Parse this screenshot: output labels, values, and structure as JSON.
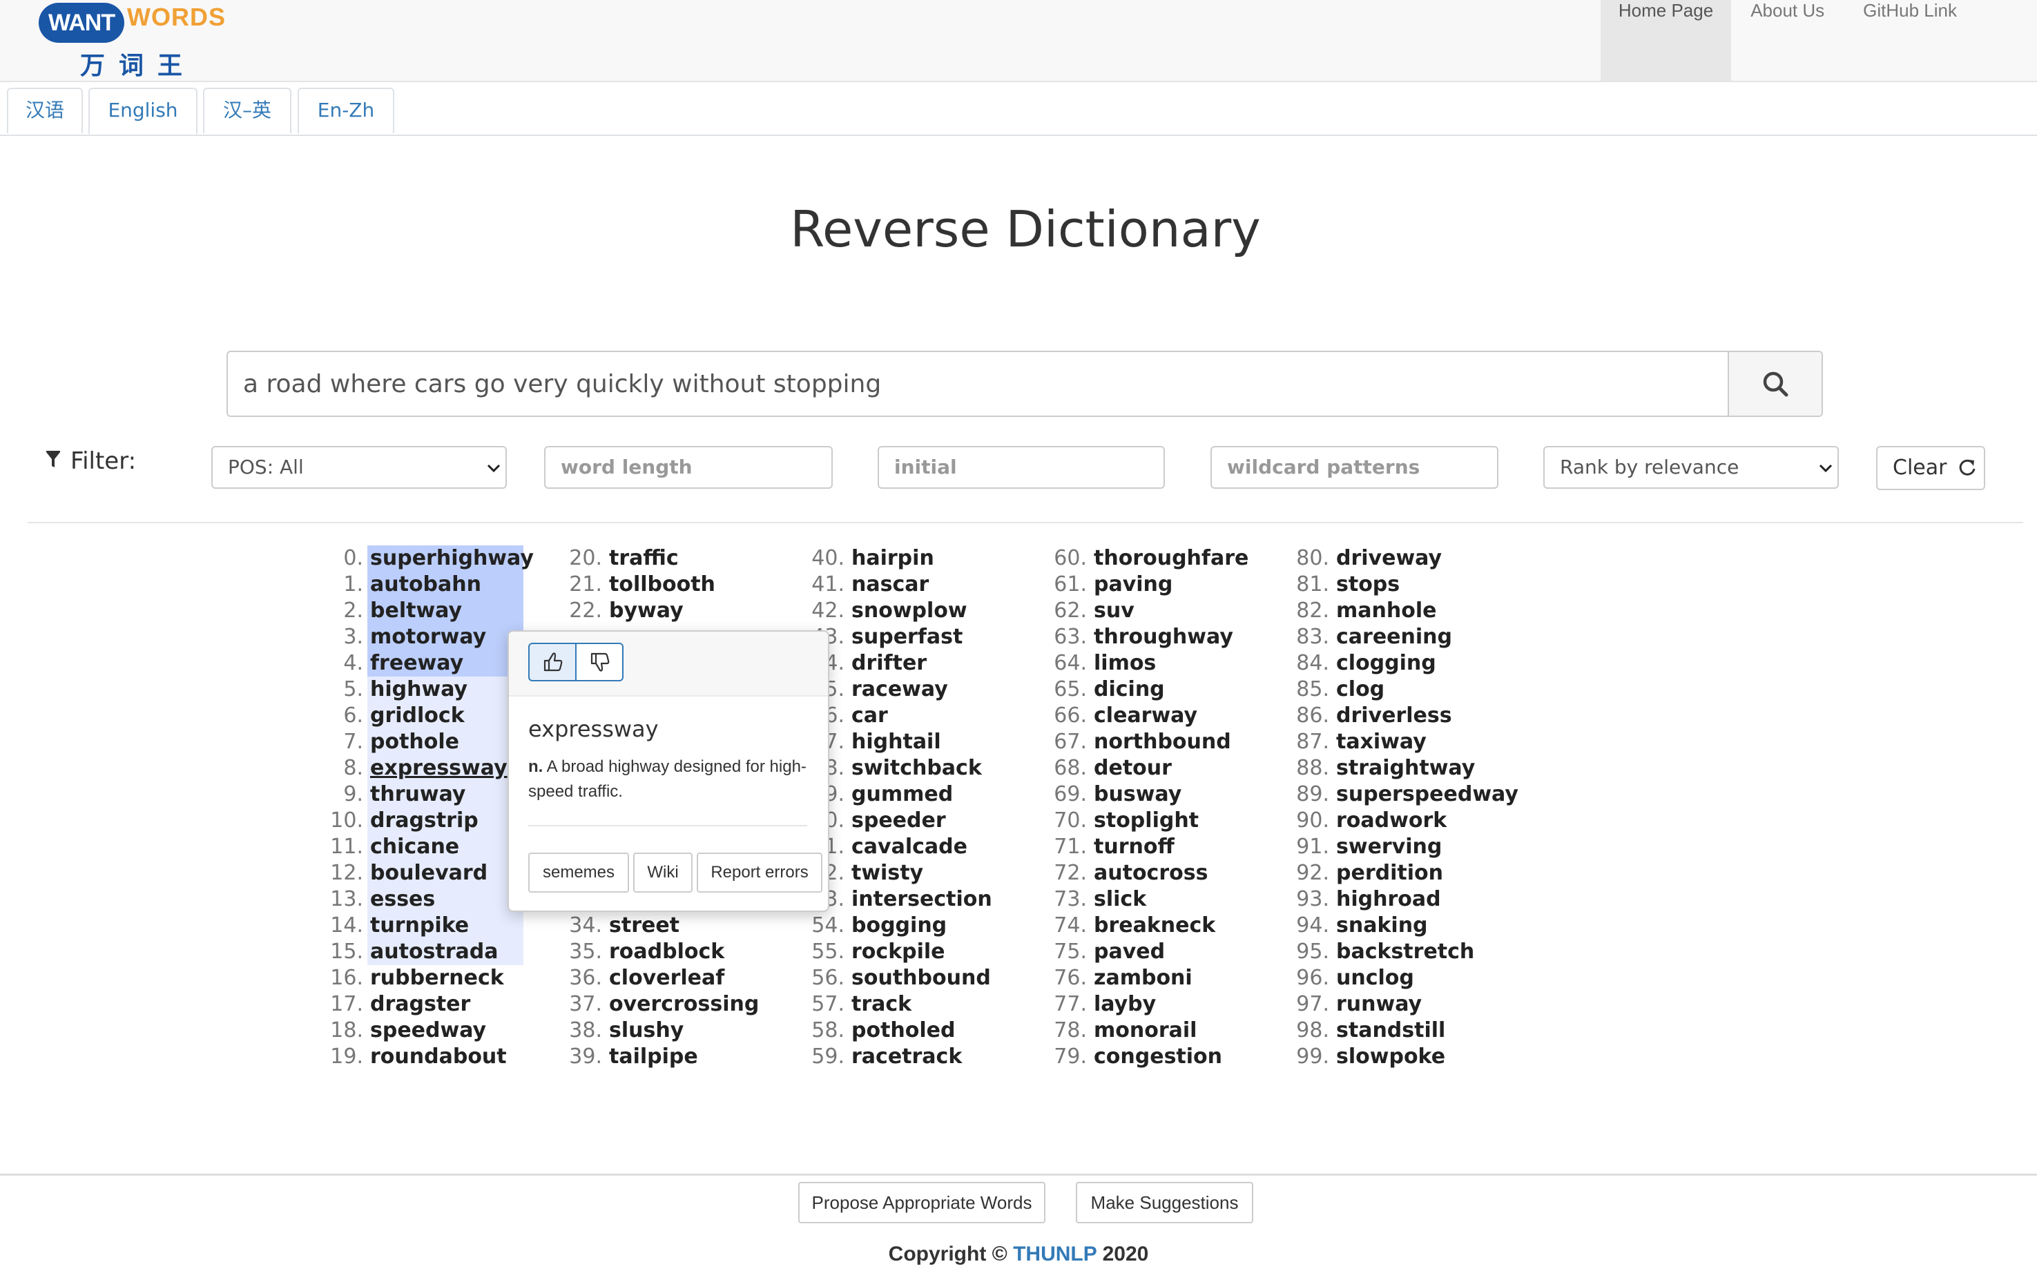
{
  "logo": {
    "want": "WANT",
    "words": "WORDS",
    "cn": "万词王"
  },
  "nav": [
    "Home Page",
    "About Us",
    "GitHub Link"
  ],
  "tabs": [
    "汉语",
    "English",
    "汉–英",
    "En-Zh"
  ],
  "title": "Reverse Dictionary",
  "search": {
    "value": "a road where cars go very quickly without stopping"
  },
  "filter": {
    "label": "Filter:",
    "pos": "POS: All",
    "word_length_placeholder": "word length",
    "initial_placeholder": "initial",
    "wildcard_placeholder": "wildcard patterns",
    "rank": "Rank by relevance",
    "clear": "Clear"
  },
  "results": [
    "superhighway",
    "autobahn",
    "beltway",
    "motorway",
    "freeway",
    "highway",
    "gridlock",
    "pothole",
    "expressway",
    "thruway",
    "dragstrip",
    "chicane",
    "boulevard",
    "esses",
    "turnpike",
    "autostrada",
    "rubberneck",
    "dragster",
    "speedway",
    "roundabout",
    "traffic",
    "tollbooth",
    "byway",
    "",
    "",
    "",
    "",
    "",
    "",
    "",
    "",
    "",
    "",
    "",
    "street",
    "roadblock",
    "cloverleaf",
    "overcrossing",
    "slushy",
    "tailpipe",
    "hairpin",
    "nascar",
    "snowplow",
    "superfast",
    "drifter",
    "raceway",
    "car",
    "hightail",
    "switchback",
    "gummed",
    "speeder",
    "cavalcade",
    "twisty",
    "intersection",
    "bogging",
    "rockpile",
    "southbound",
    "track",
    "potholed",
    "racetrack",
    "thoroughfare",
    "paving",
    "suv",
    "throughway",
    "limos",
    "dicing",
    "clearway",
    "northbound",
    "detour",
    "busway",
    "stoplight",
    "turnoff",
    "autocross",
    "slick",
    "breakneck",
    "paved",
    "zamboni",
    "layby",
    "monorail",
    "congestion",
    "driveway",
    "stops",
    "manhole",
    "careening",
    "clogging",
    "clog",
    "driverless",
    "taxiway",
    "straightway",
    "superspeedway",
    "roadwork",
    "swerving",
    "perdition",
    "highroad",
    "snaking",
    "backstretch",
    "unclog",
    "runway",
    "standstill",
    "slowpoke"
  ],
  "popover": {
    "word": "expressway",
    "pos": "n.",
    "definition": "A broad highway designed for high-speed traffic.",
    "buttons": [
      "sememes",
      "Wiki",
      "Report errors"
    ]
  },
  "footer": {
    "buttons": [
      "Propose Appropriate Words",
      "Make Suggestions"
    ],
    "copyright_prefix": "Copyright ©",
    "copyright_org": "THUNLP",
    "copyright_year": "2020"
  }
}
